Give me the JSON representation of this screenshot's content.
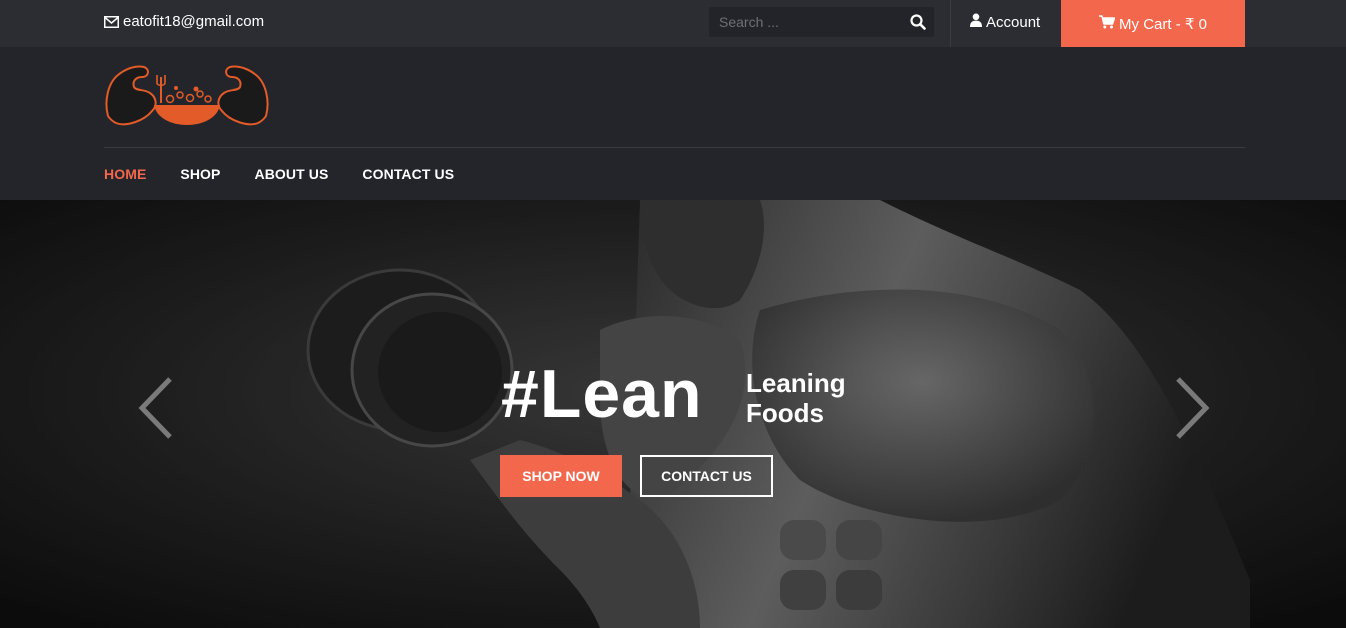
{
  "topbar": {
    "email": "eatofit18@gmail.com",
    "search_placeholder": "Search ...",
    "account_label": "Account",
    "cart_label": "My Cart - ₹ 0"
  },
  "nav": {
    "items": [
      {
        "label": "HOME",
        "active": true
      },
      {
        "label": "SHOP",
        "active": false
      },
      {
        "label": "ABOUT US",
        "active": false
      },
      {
        "label": "CONTACT US",
        "active": false
      }
    ]
  },
  "hero": {
    "title": "#Lean",
    "subtitle_line1": "Leaning",
    "subtitle_line2": "Foods",
    "primary_button": "SHOP NOW",
    "secondary_button": "CONTACT US"
  },
  "colors": {
    "accent": "#f3674d",
    "topbar_bg": "#2c2d33",
    "header_bg": "#24252b"
  },
  "icons": [
    "envelope-icon",
    "search-icon",
    "user-icon",
    "cart-icon",
    "chevron-left-icon",
    "chevron-right-icon"
  ]
}
